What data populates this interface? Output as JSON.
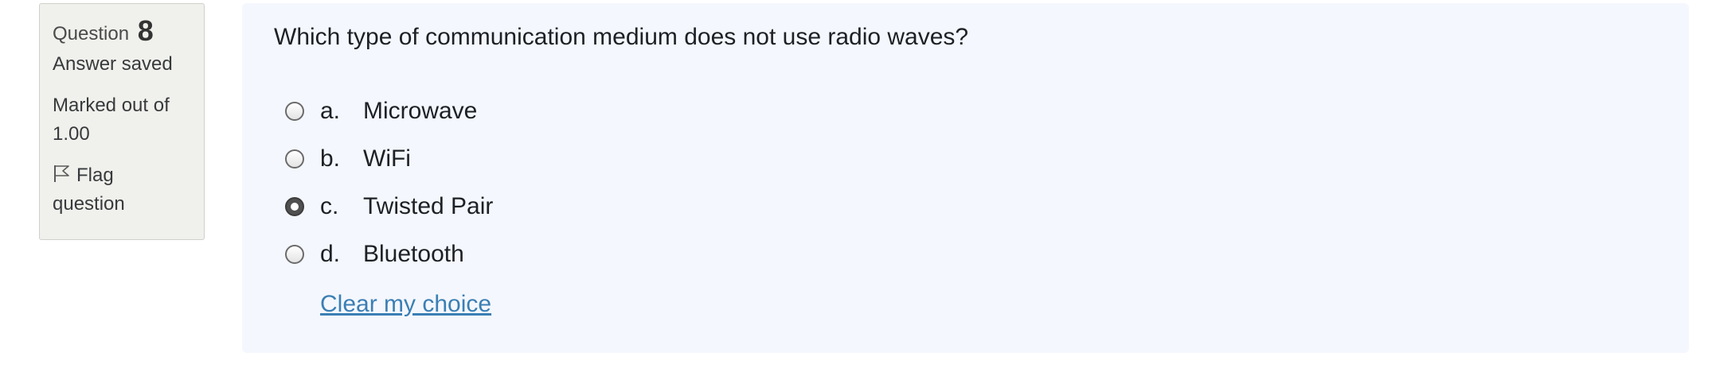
{
  "info": {
    "question_label": "Question",
    "question_number": "8",
    "state": "Answer saved",
    "grade_line1": "Marked out of",
    "grade_line2": "1.00",
    "flag_line1": "Flag",
    "flag_line2": "question"
  },
  "question": {
    "text": "Which type of communication medium does not use radio waves?",
    "options": [
      {
        "letter": "a.",
        "label": "Microwave",
        "selected": false
      },
      {
        "letter": "b.",
        "label": "WiFi",
        "selected": false
      },
      {
        "letter": "c.",
        "label": "Twisted Pair",
        "selected": true
      },
      {
        "letter": "d.",
        "label": "Bluetooth",
        "selected": false
      }
    ],
    "clear_link": "Clear my choice"
  },
  "colors": {
    "info_bg": "#f0f0ec",
    "content_bg": "#f4f7fd",
    "link": "#3b7fb4"
  },
  "icons": {
    "flag": "flag-icon"
  }
}
